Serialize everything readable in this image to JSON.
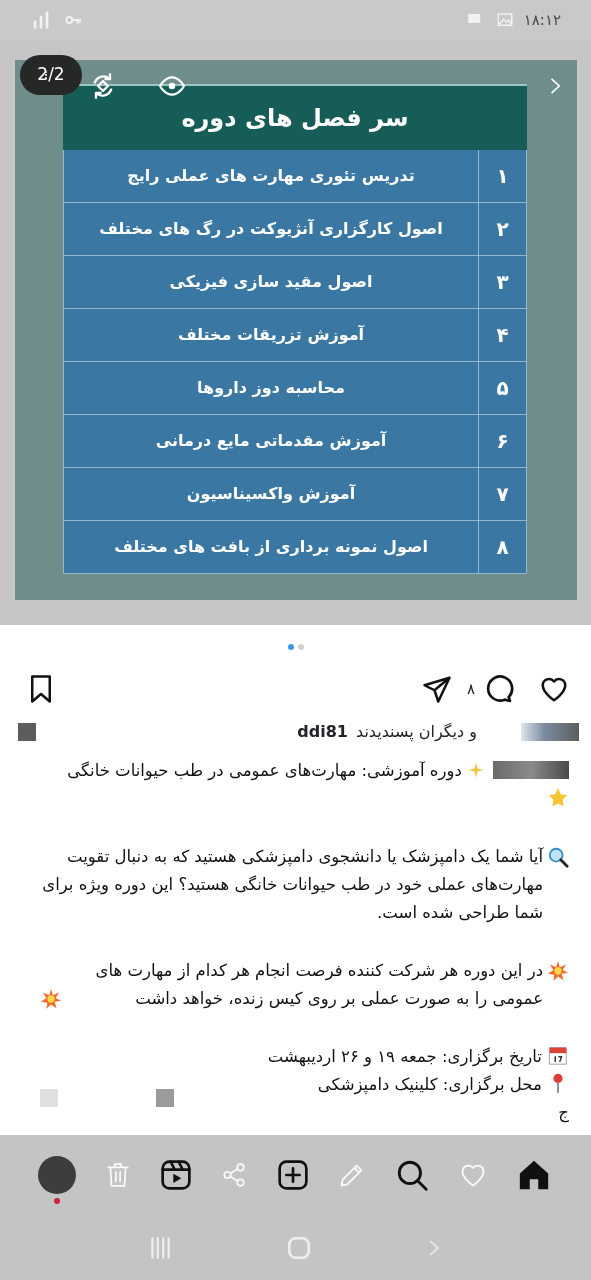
{
  "status_bar": {
    "time": "۱۸:۱۲"
  },
  "slide": {
    "counter": "2/2",
    "title": "سر فصل های دوره",
    "rows": [
      {
        "number": "۱",
        "topic": "تدریس تئوری مهارت های عملی رایج"
      },
      {
        "number": "۲",
        "topic": "اصول کارگزاری آنژیوکت در رگ های مختلف"
      },
      {
        "number": "۳",
        "topic": "اصول مقید سازی فیزیکی"
      },
      {
        "number": "۴",
        "topic": "آموزش تزریقات مختلف"
      },
      {
        "number": "۵",
        "topic": "محاسبه دوز داروها"
      },
      {
        "number": "۶",
        "topic": "آموزش مقدماتی مایع درمانی"
      },
      {
        "number": "۷",
        "topic": "آموزش واکسیناسیون"
      },
      {
        "number": "۸",
        "topic": "اصول نمونه برداری از بافت های مختلف"
      }
    ],
    "page_dots": [
      {
        "selected": true
      },
      {
        "selected": false
      }
    ]
  },
  "actions": {
    "comment_count": "۸"
  },
  "likes": {
    "username": "ddi81",
    "text": "و دیگران پسندیدند"
  },
  "caption": {
    "headline": "دوره آموزشی: مهارت‌های عمومی در طب حیوانات خانگی",
    "paragraphs": [
      {
        "kind": "question",
        "text": "آیا شما یک دامپزشک یا دانشجوی دامپزشکی هستید که به دنبال تقویت مهارت‌های عملی خود در طب حیوانات خانگی هستید؟ این دوره ویژه برای شما طراحی شده است."
      },
      {
        "kind": "burst",
        "text": "در این دوره هر شرکت کننده فرصت انجام هر کدام از مهارت های عمومی را به صورت عملی بر روی کیس زنده، خواهد داشت"
      }
    ],
    "details": [
      {
        "kind": "date",
        "text": "تاریخ برگزاری: جمعه ۱۹ و ۲۶ اردیبهشت"
      },
      {
        "kind": "place",
        "text": "محل برگزاری: کلینیک دامپزشکی"
      }
    ],
    "more": "ج"
  },
  "bottom_nav": [
    {
      "kind": "avatar"
    },
    {
      "kind": "trash"
    },
    {
      "kind": "reels"
    },
    {
      "kind": "share"
    },
    {
      "kind": "add"
    },
    {
      "kind": "edit"
    },
    {
      "kind": "search"
    },
    {
      "kind": "heart"
    },
    {
      "kind": "home"
    }
  ]
}
